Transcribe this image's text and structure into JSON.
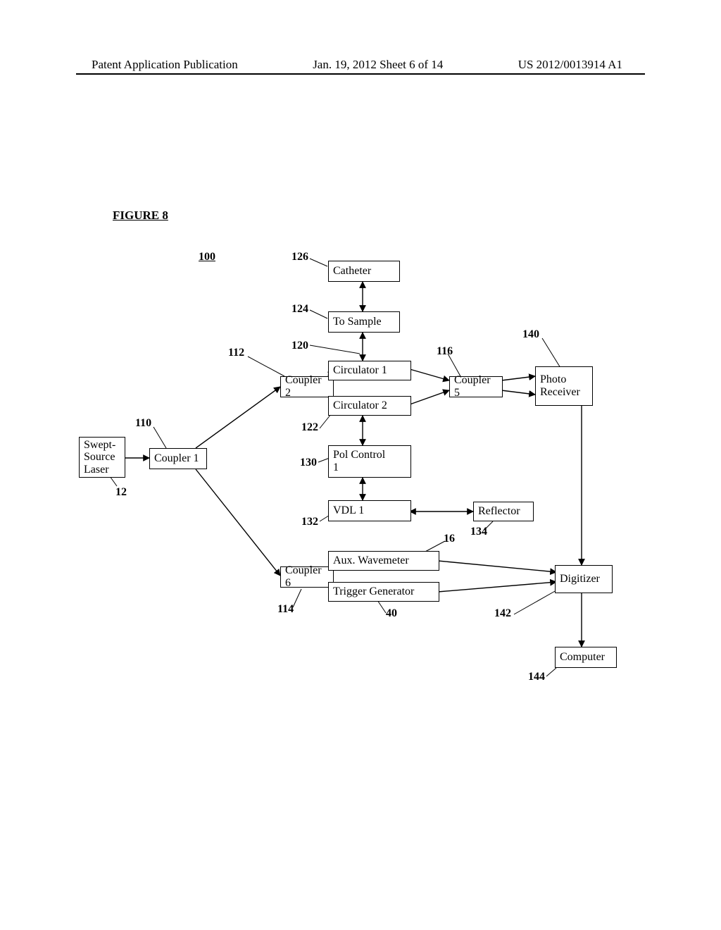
{
  "header": {
    "left": "Patent Application Publication",
    "center": "Jan. 19, 2012  Sheet 6 of 14",
    "right": "US 2012/0013914 A1"
  },
  "figure_title": "FIGURE 8",
  "labels": {
    "ref_100": "100",
    "ref_126": "126",
    "ref_124": "124",
    "ref_120": "120",
    "ref_112": "112",
    "ref_116": "116",
    "ref_140": "140",
    "ref_110": "110",
    "ref_122": "122",
    "ref_12": "12",
    "ref_130": "130",
    "ref_132": "132",
    "ref_16": "16",
    "ref_134": "134",
    "ref_114": "114",
    "ref_40": "40",
    "ref_142": "142",
    "ref_144": "144"
  },
  "boxes": {
    "laser": "Swept-\nSource\nLaser",
    "coupler1": "Coupler 1",
    "coupler2": "Coupler 2",
    "coupler5": "Coupler 5",
    "coupler6": "Coupler 6",
    "catheter": "Catheter",
    "tosample": "To Sample",
    "circ1": "Circulator 1",
    "circ2": "Circulator 2",
    "pol1": "Pol Control\n1",
    "vdl1": "VDL 1",
    "reflector": "Reflector",
    "auxwav": "Aux. Wavemeter",
    "trigger": "Trigger Generator",
    "photorx": "Photo\nReceiver",
    "digitizer": "Digitizer",
    "computer": "Computer"
  }
}
